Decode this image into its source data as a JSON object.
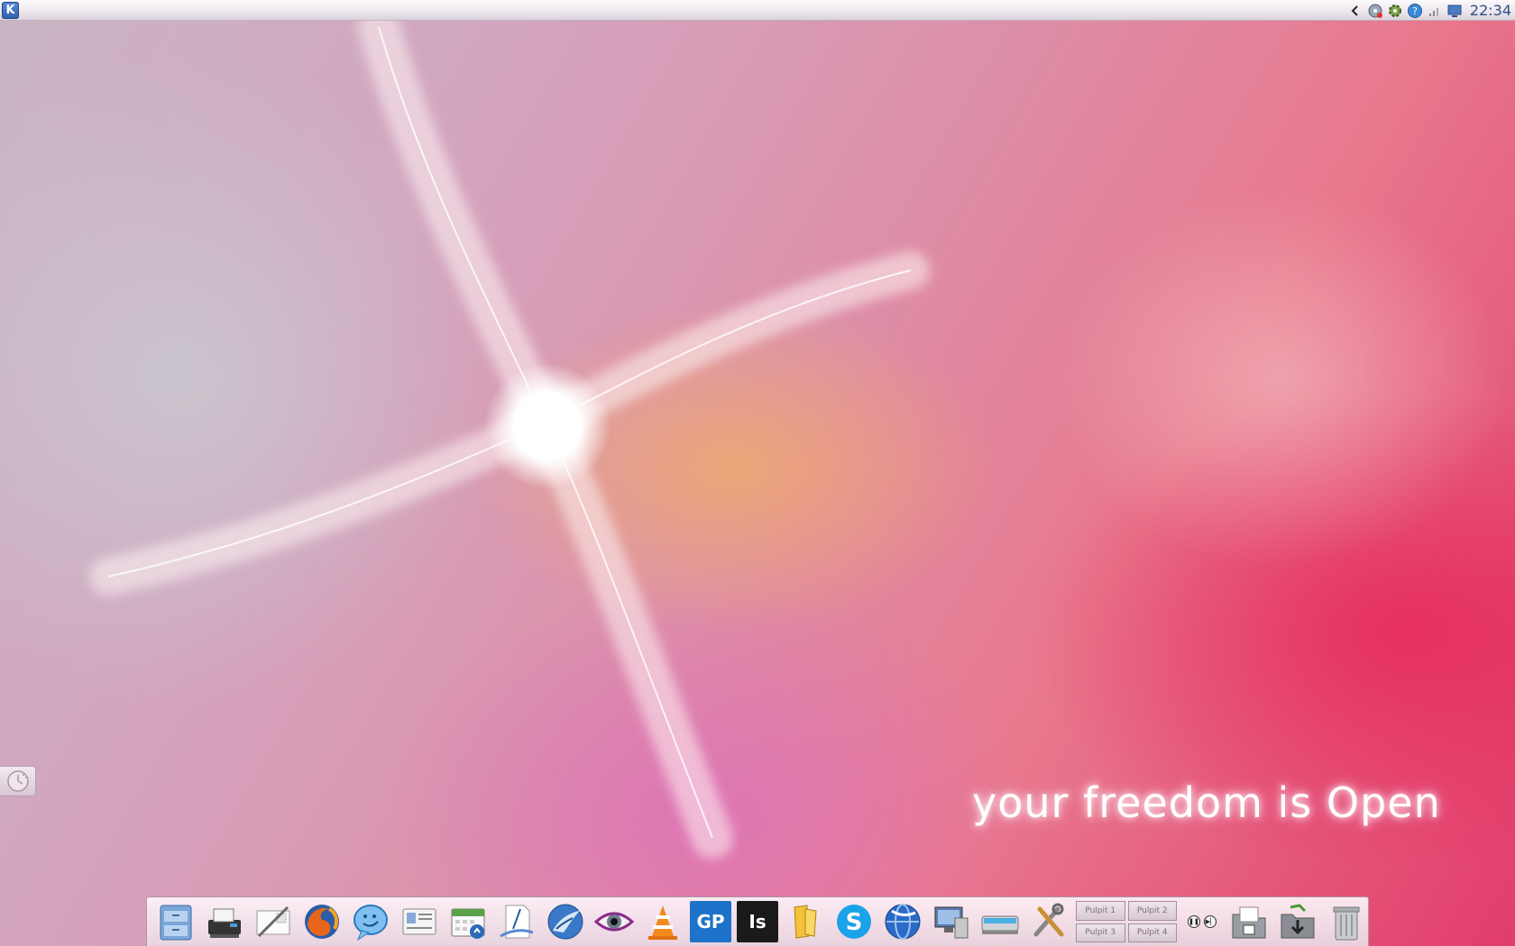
{
  "top_panel": {
    "kmenu_icon": "kde-logo-icon",
    "kmenu_label": "K",
    "tray_icons": [
      "collapse-arrow-icon",
      "network-disk-icon",
      "updates-gear-icon",
      "help-icon",
      "signal-strength-icon",
      "display-icon"
    ],
    "clock": "22:34"
  },
  "wallpaper": {
    "tagline": "your freedom is Open"
  },
  "edge_tab": {
    "icon": "clock-widget-icon"
  },
  "dock": {
    "launchers": [
      {
        "name": "file-cabinet-icon"
      },
      {
        "name": "printer-fax-icon"
      },
      {
        "name": "mail-stamp-icon"
      },
      {
        "name": "firefox-icon"
      },
      {
        "name": "chat-bubble-icon"
      },
      {
        "name": "contacts-card-icon"
      },
      {
        "name": "calendar-icon"
      },
      {
        "name": "document-writer-icon"
      },
      {
        "name": "thunderbird-icon"
      },
      {
        "name": "eye-viewer-icon"
      },
      {
        "name": "vlc-cone-icon"
      },
      {
        "name": "gp-icon",
        "label": "GP"
      },
      {
        "name": "is-icon",
        "label": "Is"
      },
      {
        "name": "office-suite-icon"
      },
      {
        "name": "skype-icon"
      },
      {
        "name": "browser-globe-icon"
      },
      {
        "name": "remote-desktop-icon"
      },
      {
        "name": "scanner-icon"
      },
      {
        "name": "tools-icon"
      }
    ],
    "pager": [
      "Pulpit 1",
      "Pulpit 2",
      "Pulpit 3",
      "Pulpit 4"
    ],
    "media": {
      "pause": "pause-icon",
      "next": "next-track-icon"
    },
    "end_items": [
      {
        "name": "documents-folder-icon"
      },
      {
        "name": "downloads-folder-icon"
      },
      {
        "name": "trash-can-icon"
      }
    ]
  },
  "colors": {
    "accent_blue": "#2c5fb0",
    "clock_blue": "#2d4f86"
  }
}
